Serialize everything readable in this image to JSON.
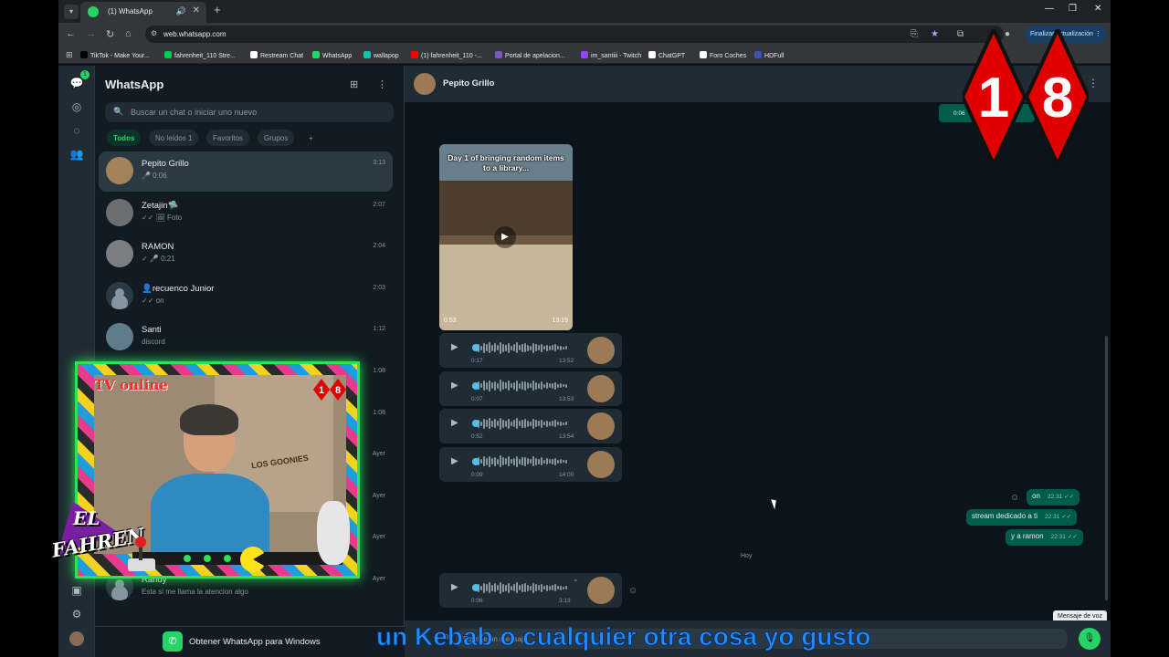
{
  "browser": {
    "tab_title": "(1) WhatsApp",
    "url": "web.whatsapp.com",
    "update_button": "Finalizar actualización",
    "bookmarks": [
      {
        "label": "TikTok - Make Your...",
        "color": "#000000"
      },
      {
        "label": "fahrenheit_110 Stre...",
        "color": "#00c853"
      },
      {
        "label": "Restream Chat",
        "color": "#ffffff"
      },
      {
        "label": "WhatsApp",
        "color": "#25d366"
      },
      {
        "label": "wallapop",
        "color": "#13c1ac"
      },
      {
        "label": "(1) fahrenheit_110 -...",
        "color": "#ff0000"
      },
      {
        "label": "Portal de apelacion...",
        "color": "#7e57c2"
      },
      {
        "label": "im_santiii - Twitch",
        "color": "#9146ff"
      },
      {
        "label": "ChatGPT",
        "color": "#ffffff"
      },
      {
        "label": "Foro Coches",
        "color": "#ffffff"
      },
      {
        "label": "HDFull",
        "color": "#3f51b5"
      }
    ]
  },
  "rail": {
    "unread_badge": "1"
  },
  "sidebar": {
    "title": "WhatsApp",
    "search_placeholder": "Buscar un chat o iniciar uno nuevo",
    "filters": [
      "Todos",
      "No leídos 1",
      "Favoritos",
      "Grupos",
      "+"
    ],
    "chats": [
      {
        "name": "Pepito Grillo",
        "preview": "🎤 0:06",
        "time": "3:13"
      },
      {
        "name": "Zetajin🛸",
        "preview": "✓✓ 🖼 Foto",
        "time": "2:07"
      },
      {
        "name": "RAMON",
        "preview": "✓ 🎤 0:21",
        "time": "2:04"
      },
      {
        "name": "👤recuenco Junior",
        "preview": "✓✓ on",
        "time": "2:03"
      },
      {
        "name": "Santi",
        "preview": "discord",
        "time": "1:12"
      },
      {
        "name": "",
        "preview": "",
        "time": "1:08"
      },
      {
        "name": "",
        "preview": "",
        "time": "1:08"
      },
      {
        "name": "",
        "preview": "",
        "time": "Ayer"
      },
      {
        "name": "",
        "preview": "",
        "time": "Ayer"
      },
      {
        "name": "",
        "preview": "",
        "time": "Ayer"
      },
      {
        "name": "Randy",
        "preview": "Esta si me llama la atencion algo",
        "time": "Ayer"
      }
    ],
    "get_app": "Obtener WhatsApp para Windows"
  },
  "conversation": {
    "contact_name": "Pepito Grillo",
    "mini_video_duration": "0:06",
    "video": {
      "caption": "Day 1 of bringing random items to a library...",
      "duration": "0:53",
      "time": "13:19"
    },
    "voice_notes": [
      {
        "duration": "0:17",
        "time": "13:52",
        "progress": 0.0
      },
      {
        "duration": "0:07",
        "time": "13:53",
        "progress": 0.0
      },
      {
        "duration": "0:52",
        "time": "13:54",
        "progress": 0.0
      },
      {
        "duration": "0:09",
        "time": "14:00",
        "progress": 0.0
      }
    ],
    "outgoing": [
      {
        "text": "on",
        "time": "22:31"
      },
      {
        "text": "stream dedicado a ti",
        "time": "22:31"
      },
      {
        "text": "y a ramon",
        "time": "22:31"
      }
    ],
    "day_label": "Hoy",
    "latest_voice": {
      "duration": "0:06",
      "time": "3:13"
    },
    "composer_placeholder": "Escribe un mensaje",
    "mic_tooltip": "Mensaje de voz"
  },
  "overlay": {
    "cam_title": "TV online",
    "badge_digits": [
      "1",
      "8"
    ],
    "brand_top": "EL",
    "brand_bottom": "FAHREN",
    "subtitle": "un Kebab o cualquier otra cosa yo gusto",
    "poster_text": "LOS GOONIES"
  },
  "colors": {
    "accent": "#25d366",
    "outgoing_bubble": "#005c4b",
    "incoming_bubble": "#202c33",
    "badge_red": "#e00000"
  }
}
